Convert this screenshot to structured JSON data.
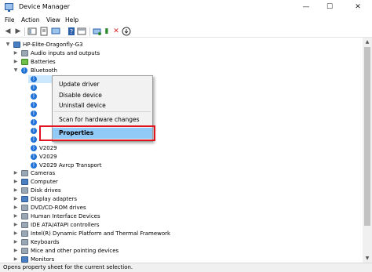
{
  "window": {
    "title": "Device Manager",
    "minimize": "—",
    "maximize": "☐",
    "close": "✕"
  },
  "menu": [
    "File",
    "Action",
    "View",
    "Help"
  ],
  "tree": {
    "root": "HP-Elite-Dragonfly-G3",
    "categories_top": [
      "Audio inputs and outputs",
      "Batteries",
      "Bluetooth"
    ],
    "bluetooth_children": [
      "V2029",
      "V2029",
      "V2029 Avrcp Transport"
    ],
    "categories_bottom": [
      "Cameras",
      "Computer",
      "Disk drives",
      "Display adapters",
      "DVD/CD-ROM drives",
      "Human Interface Devices",
      "IDE ATA/ATAPI controllers",
      "Intel(R) Dynamic Platform and Thermal Framework",
      "Keyboards",
      "Mice and other pointing devices",
      "Monitors"
    ]
  },
  "context_menu": {
    "update_driver": "Update driver",
    "disable_device": "Disable device",
    "uninstall_device": "Uninstall device",
    "scan_hardware": "Scan for hardware changes",
    "properties": "Properties"
  },
  "status": "Opens property sheet for the current selection.",
  "colors": {
    "highlight": "#91c9f7",
    "annotation_red": "#e0141e",
    "bluetooth_icon": "#1f72d8"
  }
}
